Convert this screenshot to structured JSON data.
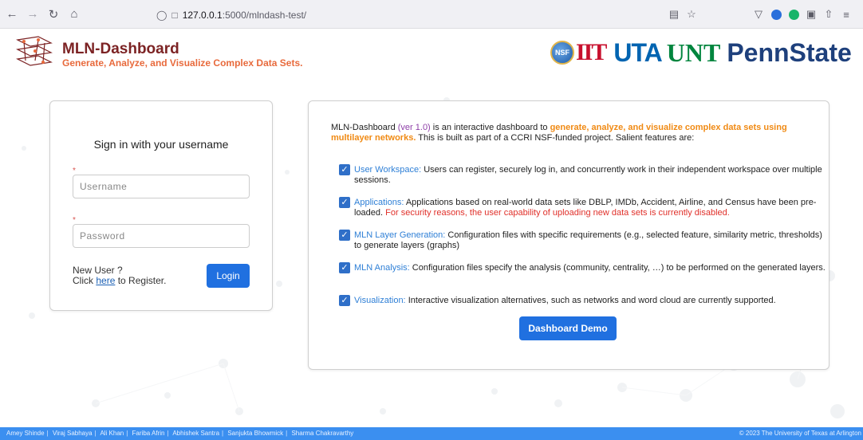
{
  "browser": {
    "url_prefix": "127.0.0.1",
    "url_rest": ":5000/mlndash-test/",
    "icons": [
      "back-icon",
      "forward-icon",
      "reload-icon",
      "home-icon",
      "shield-icon",
      "page-icon",
      "reader-icon",
      "star-icon",
      "pocket-icon",
      "extension-icon",
      "menu-icon"
    ]
  },
  "header": {
    "title": "MLN-Dashboard",
    "subtitle": "Generate, Analyze, and Visualize Complex Data Sets.",
    "partners": {
      "nsf": "NSF",
      "iit": "IIT",
      "uta": "UTA",
      "unt": "UNT",
      "psu": "PennState"
    }
  },
  "signin": {
    "title": "Sign in with your username",
    "required_mark": "*",
    "username_placeholder": "Username",
    "password_placeholder": "Password",
    "new_user_line": "New User ?",
    "click_text": "Click",
    "here_link": "here",
    "register_text": "to Register.",
    "login_label": "Login"
  },
  "info": {
    "intro_name": "MLN-Dashboard",
    "intro_version": "(ver 1.0)",
    "intro_mid": "is an interactive dashboard to",
    "intro_highlight": "generate, analyze, and visualize complex data sets using multilayer networks.",
    "intro_rest": "This is built as part of a CCRI NSF-funded project. Salient features are:",
    "features": [
      {
        "title": "User Workspace:",
        "text": "Users can register, securely log in, and concurrently work in their independent workspace over multiple sessions.",
        "warning": ""
      },
      {
        "title": "Applications:",
        "text": "Applications based on real-world data sets like DBLP, IMDb, Accident, Airline, and Census have been pre-loaded.",
        "warning": "For security reasons, the user capability of uploading new data sets is currently disabled."
      },
      {
        "title": "MLN Layer Generation:",
        "text": "Configuration files with specific requirements (e.g., selected feature, similarity metric, thresholds) to generate layers (graphs)",
        "warning": ""
      },
      {
        "title": "MLN Analysis:",
        "text": "Configuration files specify the analysis (community, centrality, …) to be performed on the generated layers.",
        "warning": ""
      },
      {
        "title": "Visualization:",
        "text": "Interactive visualization alternatives, such as networks and word cloud are currently supported.",
        "warning": ""
      }
    ],
    "demo_label": "Dashboard Demo"
  },
  "footer": {
    "authors": [
      "Amey Shinde",
      "Viraj Sabhaya",
      "Ali Khan",
      "Fariba Afrin",
      "Abhishek Santra",
      "Sanjukta Bhowmick",
      "Sharma Chakravarthy"
    ],
    "separator": "|",
    "copyright": "© 2023 The University of Texas at Arlington"
  }
}
